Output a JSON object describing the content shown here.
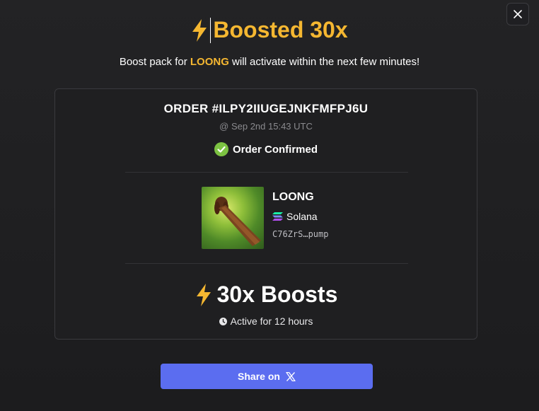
{
  "header": {
    "title": "Boosted 30x",
    "subtitle_prefix": "Boost pack for",
    "subtitle_token": "LOONG",
    "subtitle_suffix": "will activate within the next few minutes!"
  },
  "order": {
    "id": "ORDER #ILPY2IIUGEJNKFMFPJ6U",
    "time": "@ Sep 2nd 15:43 UTC",
    "status": "Order Confirmed"
  },
  "token": {
    "name": "LOONG",
    "chain": "Solana",
    "address": "C76ZrS…pump",
    "image_icon": "dog-photo"
  },
  "boost": {
    "amount": "30x Boosts",
    "duration": "Active for 12 hours"
  },
  "share": {
    "label": "Share on",
    "icon": "x-logo-icon"
  },
  "colors": {
    "accent": "#f5b731",
    "confirmed": "#7cc242",
    "button": "#5b6df0"
  }
}
